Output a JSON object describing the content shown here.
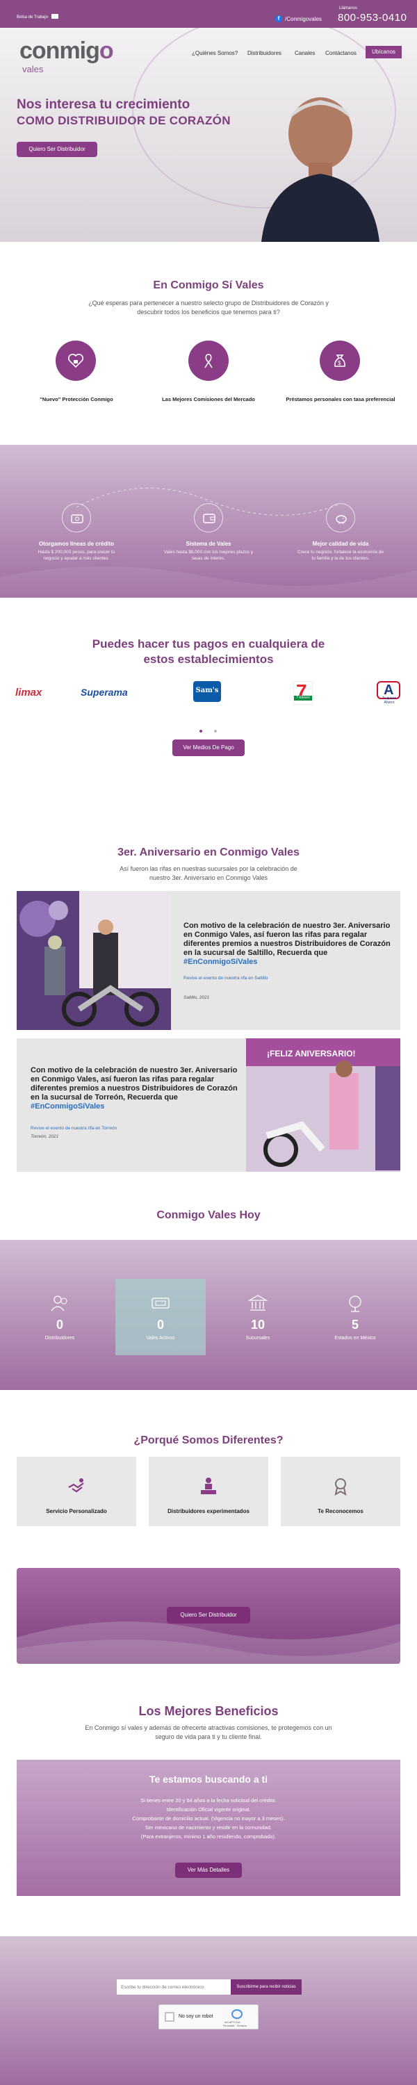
{
  "topbar": {
    "job_link": "Bolsa de Trabajo",
    "mail_icon": "envelope-icon",
    "facebook_handle": "/Conmigovales",
    "call_label": "Llámanos",
    "phone": "800-953-0410"
  },
  "brand": {
    "logo_main": "conmigo",
    "logo_sub": "vales",
    "primary_color": "#8a3d86"
  },
  "nav": {
    "items": [
      "¿Quiénes Somos?",
      "Distribuidores",
      "Canales",
      "Contáctanos"
    ],
    "cta": "Ubícanos"
  },
  "hero": {
    "line1": "Nos interesa tu crecimiento",
    "line2": "COMO DISTRIBUIDOR DE CORAZÓN",
    "cta": "Quiero Ser Distribuidor"
  },
  "intro": {
    "title": "En Conmigo Sí Vales",
    "text": "¿Qué esperas para pertenecer a nuestro selecto grupo de Distribuidores de Corazón y descubrir todos los beneficios que tenemos para ti?",
    "features": [
      {
        "icon": "heart-lock-icon",
        "label": "\"Nuevo\" Protección Conmigo"
      },
      {
        "icon": "ribbon-icon",
        "label": "Las Mejores Comisiones del Mercado"
      },
      {
        "icon": "money-bag-icon",
        "label": "Préstamos personales con tasa preferencial"
      }
    ]
  },
  "benefits_band": [
    {
      "icon": "credit-icon",
      "title": "Otorgamos líneas de crédito",
      "desc": "Hasta $ 200,000 pesos, para crecer tu negocio y ayudar a más clientes."
    },
    {
      "icon": "wallet-icon",
      "title": "Sistema de Vales",
      "desc": "Vales hasta $6,000 con los mejores plazos y tasas de interés."
    },
    {
      "icon": "piggy-bank-icon",
      "title": "Mejor calidad de vida",
      "desc": "Crece tu negocio, fortalece la economía de tu familia y la de tus clientes."
    }
  ],
  "payments": {
    "title": "Puedes hacer tus pagos en cualquiera de estos establecimientos",
    "stores": [
      "limax",
      "Superama",
      "Sam's",
      "7-Eleven",
      "Ahorro"
    ],
    "ahorro_tagline": "Te quiere",
    "cta": "Ver Medios De Pago"
  },
  "anniversary": {
    "title": "3er. Aniversario en Conmigo Vales",
    "text": "Así fueron las rifas en nuestras sucursales por la celebración de nuestro 3er. Aniversario en Conmigo Vales",
    "cards": [
      {
        "title": "Con motivo de la celebración de nuestro 3er. Aniversario en Conmigo Vales, así fueron las rifas para regalar diferentes premios a nuestros Distribuidores de Corazón en la sucursal de Saltillo, Recuerda que",
        "tag": "#EnConmigoSíVales",
        "link": "Revive el evento de nuestra rifa en Saltillo",
        "date": "Saltillo, 2021"
      },
      {
        "title": "Con motivo de la celebración de nuestro 3er. Aniversario en Conmigo Vales, así fueron las rifas para regalar diferentes premios a nuestros Distribuidores de Corazón en la sucursal de Torreón, Recuerda que",
        "tag": "#EnConmigoSíVales",
        "link": "Revive el evento de nuestra rifa en Torreón",
        "date": "Torreón, 2021",
        "banner_text": "¡FELIZ ANIVERSARIO!"
      }
    ]
  },
  "today": {
    "title": "Conmigo Vales Hoy",
    "stats": [
      {
        "icon": "people-icon",
        "value": "0",
        "label": "Distribuidores"
      },
      {
        "icon": "ticket-icon",
        "value": "0",
        "label": "Vales Activos"
      },
      {
        "icon": "bank-icon",
        "value": "10",
        "label": "Sucursales"
      },
      {
        "icon": "globe-pin-icon",
        "value": "5",
        "label": "Estados en México"
      }
    ]
  },
  "different": {
    "title": "¿Porqué Somos Diferentes?",
    "items": [
      {
        "icon": "handshake-icon",
        "label": "Servicio Personalizado"
      },
      {
        "icon": "podium-icon",
        "label": "Distribuidores experimentados"
      },
      {
        "icon": "medal-icon",
        "label": "Te Reconocemos"
      }
    ],
    "cta": "Quiero Ser Distribuidor"
  },
  "best": {
    "title": "Los Mejores Beneficios",
    "text": "En Conmigo sí vales y además de ofrecerte atractivas comisiones, te protegemos con un seguro de vida para ti y tu cliente final.",
    "box_title": "Te estamos buscando a ti",
    "requirements": [
      "Si tienes entre 20 y 64 años a la fecha solicitud del crédito.",
      "Identificación Oficial vigente original.",
      "Comprobante de domicilio actual. (Vigencia no mayor a 3 meses).",
      "Ser mexicano de nacimiento y residir en la comunidad.",
      "(Para extranjeros, mínimo 1 año residiendo, comprobado)."
    ],
    "cta": "Ver Más Detalles"
  },
  "newsletter": {
    "placeholder": "Escribe tu dirección de correo electrónico",
    "button": "Suscribirme para recibir noticias",
    "captcha_label": "No soy un robot",
    "captcha_brand": "reCAPTCHA",
    "captcha_terms": "Privacidad - Términos"
  }
}
